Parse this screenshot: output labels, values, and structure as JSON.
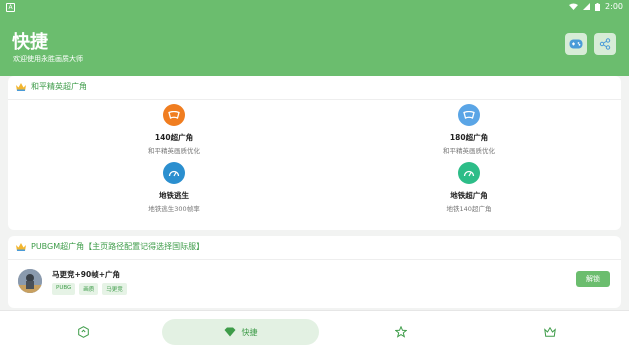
{
  "statusbar": {
    "time": "2:00"
  },
  "header": {
    "title": "快捷",
    "subtitle": "欢迎使用永胜画质大师"
  },
  "section1": {
    "title": "和平精英超广角",
    "features": [
      {
        "name": "140超广角",
        "desc": "和平精英画质优化",
        "icon": "wide-angle-icon",
        "color": "#f07d20"
      },
      {
        "name": "180超广角",
        "desc": "和平精英画质优化",
        "icon": "wide-angle-icon",
        "color": "#5aa5e6"
      },
      {
        "name": "地铁逃生",
        "desc": "地铁逃生300帧率",
        "icon": "speedometer-icon",
        "color": "#2b8fcf"
      },
      {
        "name": "地铁超广角",
        "desc": "地铁140超广角",
        "icon": "speedometer-icon",
        "color": "#2dbd88"
      }
    ]
  },
  "section2": {
    "title": "PUBGM超广角【主页路径配置记得选择国际服】",
    "item": {
      "name": "马更竞+90帧+广角",
      "tags": [
        "PUBG",
        "画质",
        "马更竞"
      ],
      "button": "解锁"
    }
  },
  "nav": {
    "items": [
      {
        "label": ""
      },
      {
        "label": "快捷"
      },
      {
        "label": ""
      },
      {
        "label": ""
      }
    ]
  },
  "colors": {
    "primary": "#6bbd6e",
    "text_green": "#3e9c49"
  }
}
